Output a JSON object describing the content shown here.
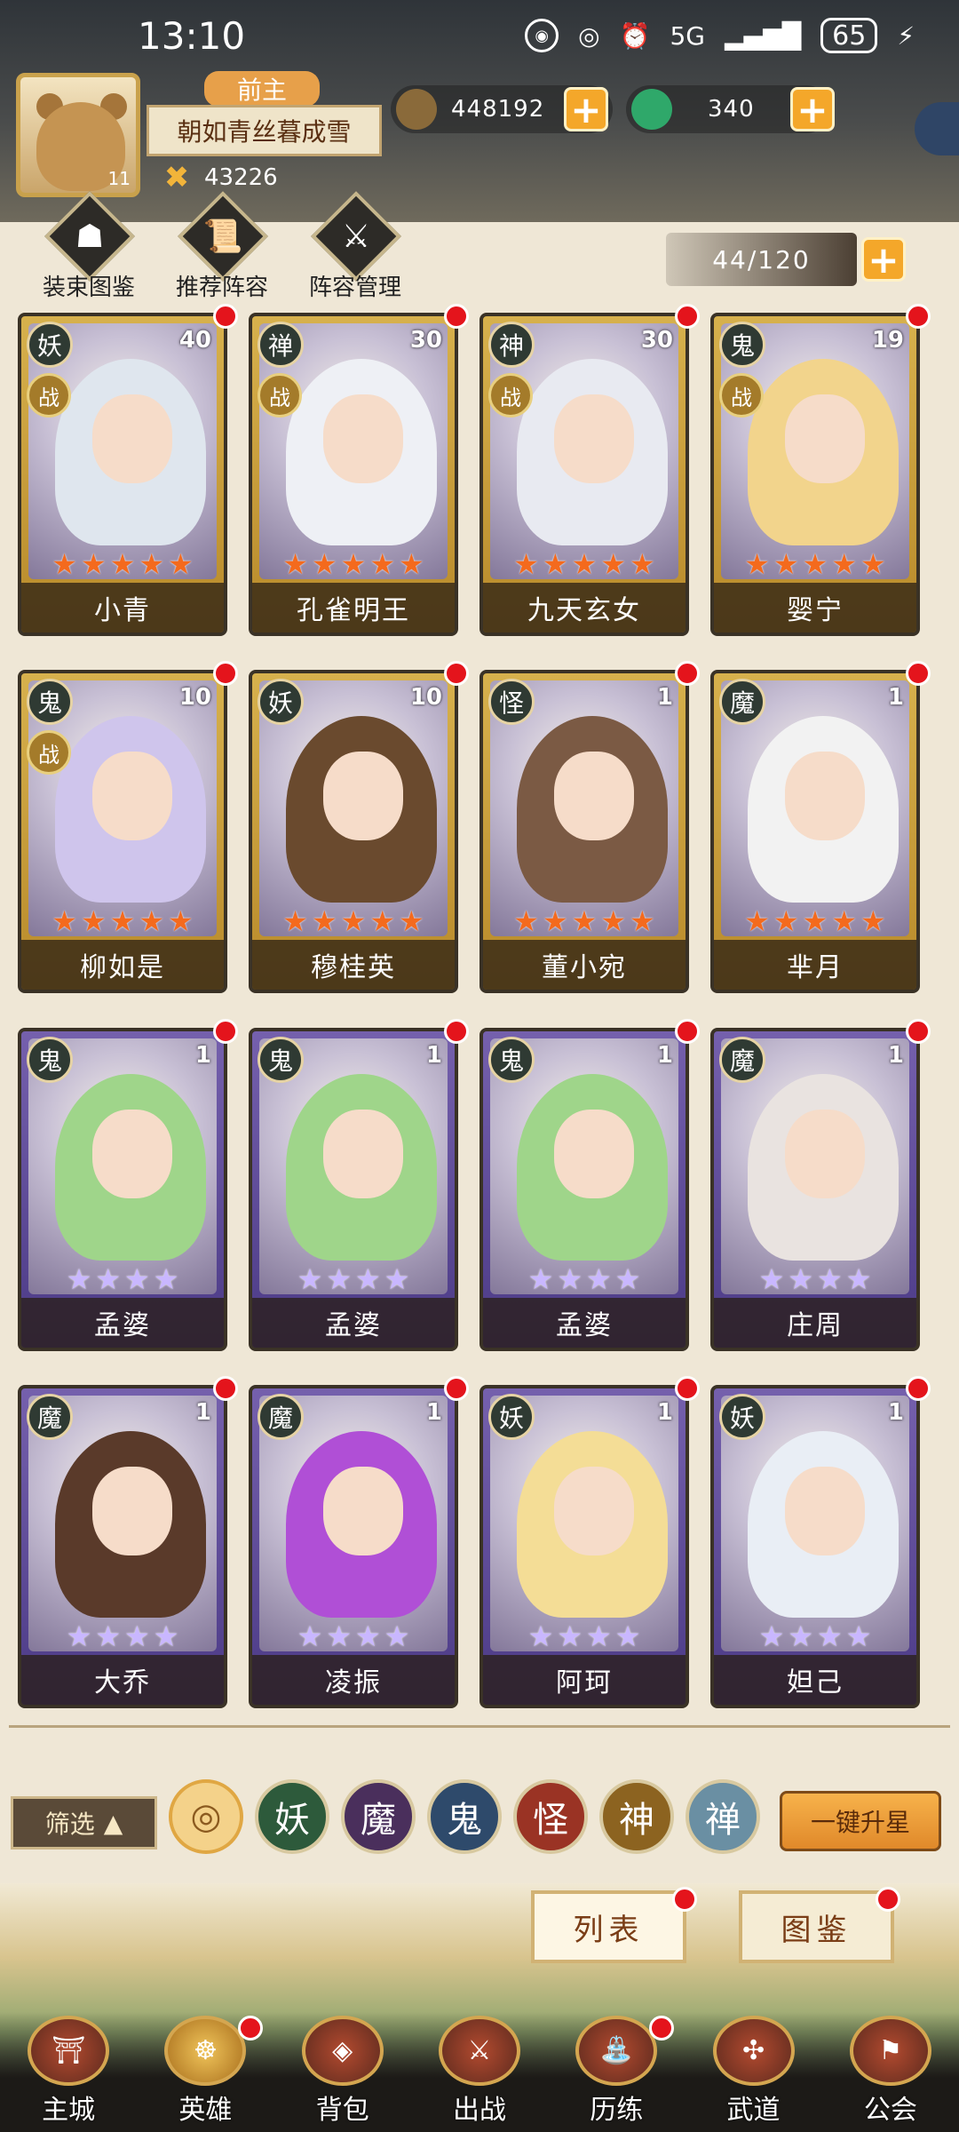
{
  "status_bar": {
    "time": "13:10",
    "battery": "65",
    "network": "5G"
  },
  "player": {
    "avatar_level": "11",
    "title_badge": "前主",
    "name": "朝如青丝暮成雪",
    "power": "43226"
  },
  "currencies": [
    {
      "name": "copper-coin",
      "amount": "448192",
      "color": "#8a6a3a"
    },
    {
      "name": "jade",
      "amount": "340",
      "color": "#2fa86a"
    }
  ],
  "tools": [
    {
      "label": "装束图鉴",
      "icon": "costume-icon"
    },
    {
      "label": "推荐阵容",
      "icon": "scroll-icon"
    },
    {
      "label": "阵容管理",
      "icon": "swords-icon"
    }
  ],
  "capacity": "44/120",
  "heroes": [
    {
      "name": "小青",
      "faction": "妖",
      "level": "40",
      "combat": "战",
      "stars": 5,
      "rarity": "gold",
      "hair": "#dfe6ee"
    },
    {
      "name": "孔雀明王",
      "faction": "禅",
      "level": "30",
      "combat": "战",
      "stars": 5,
      "rarity": "gold",
      "hair": "#eef0f5"
    },
    {
      "name": "九天玄女",
      "faction": "神",
      "level": "30",
      "combat": "战",
      "stars": 5,
      "rarity": "gold",
      "hair": "#e8eaf1"
    },
    {
      "name": "婴宁",
      "faction": "鬼",
      "level": "19",
      "combat": "战",
      "stars": 5,
      "rarity": "gold",
      "hair": "#f2d48c"
    },
    {
      "name": "柳如是",
      "faction": "鬼",
      "level": "10",
      "combat": "战",
      "stars": 5,
      "rarity": "gold",
      "hair": "#cfc5ec"
    },
    {
      "name": "穆桂英",
      "faction": "妖",
      "level": "10",
      "combat": "",
      "stars": 5,
      "rarity": "gold",
      "hair": "#6a4a2e"
    },
    {
      "name": "董小宛",
      "faction": "怪",
      "level": "1",
      "combat": "",
      "stars": 5,
      "rarity": "gold",
      "hair": "#7b5a44"
    },
    {
      "name": "芈月",
      "faction": "魔",
      "level": "1",
      "combat": "",
      "stars": 5,
      "rarity": "gold",
      "hair": "#f2f2f2"
    },
    {
      "name": "孟婆",
      "faction": "鬼",
      "level": "1",
      "combat": "",
      "stars": 4,
      "rarity": "purple",
      "hair": "#9fd58a"
    },
    {
      "name": "孟婆",
      "faction": "鬼",
      "level": "1",
      "combat": "",
      "stars": 4,
      "rarity": "purple",
      "hair": "#9fd58a"
    },
    {
      "name": "孟婆",
      "faction": "鬼",
      "level": "1",
      "combat": "",
      "stars": 4,
      "rarity": "purple",
      "hair": "#9fd58a"
    },
    {
      "name": "庄周",
      "faction": "魔",
      "level": "1",
      "combat": "",
      "stars": 4,
      "rarity": "purple",
      "hair": "#e9e3e0"
    },
    {
      "name": "大乔",
      "faction": "魔",
      "level": "1",
      "combat": "",
      "stars": 4,
      "rarity": "purple",
      "hair": "#5a3a2a"
    },
    {
      "name": "凌振",
      "faction": "魔",
      "level": "1",
      "combat": "",
      "stars": 4,
      "rarity": "purple",
      "hair": "#b04fd6"
    },
    {
      "name": "阿珂",
      "faction": "妖",
      "level": "1",
      "combat": "",
      "stars": 4,
      "rarity": "purple",
      "hair": "#f4dd96"
    },
    {
      "name": "妲己",
      "faction": "妖",
      "level": "1",
      "combat": "",
      "stars": 4,
      "rarity": "purple",
      "hair": "#e9eef5"
    }
  ],
  "filter": {
    "label": "筛选",
    "factions": [
      {
        "label": "",
        "color": "#f4d28a",
        "all": true
      },
      {
        "label": "妖",
        "color": "#2d5a3b"
      },
      {
        "label": "魔",
        "color": "#4a2f5c"
      },
      {
        "label": "鬼",
        "color": "#2e4a6b"
      },
      {
        "label": "怪",
        "color": "#9a3324"
      },
      {
        "label": "神",
        "color": "#8c6320"
      },
      {
        "label": "禅",
        "color": "#6a8fa3"
      }
    ],
    "upgrade_label": "一键升星"
  },
  "view_tabs": [
    {
      "label": "列表"
    },
    {
      "label": "图鉴"
    }
  ],
  "nav": [
    {
      "label": "主城",
      "icon": "city-gate-icon"
    },
    {
      "label": "英雄",
      "icon": "hero-hat-icon",
      "active": true
    },
    {
      "label": "背包",
      "icon": "bag-icon"
    },
    {
      "label": "出战",
      "icon": "crossed-swords-icon"
    },
    {
      "label": "历练",
      "icon": "fountain-icon"
    },
    {
      "label": "武道",
      "icon": "martial-icon"
    },
    {
      "label": "公会",
      "icon": "guild-icon"
    }
  ]
}
